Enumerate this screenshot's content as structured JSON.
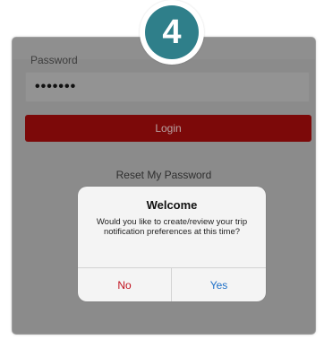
{
  "step_badge": {
    "number": "4"
  },
  "login_form": {
    "password_label": "Password",
    "password_value": "•••••••",
    "login_button_label": "Login",
    "reset_link_label": "Reset My Password"
  },
  "dialog": {
    "title": "Welcome",
    "message": "Would you like to create/review your trip notification preferences at this time?",
    "no_label": "No",
    "yes_label": "Yes"
  },
  "colors": {
    "step_badge": "#2f7f8a",
    "login_button": "#7c0909",
    "no_button": "#c1121f",
    "yes_button": "#1d6fc7"
  }
}
